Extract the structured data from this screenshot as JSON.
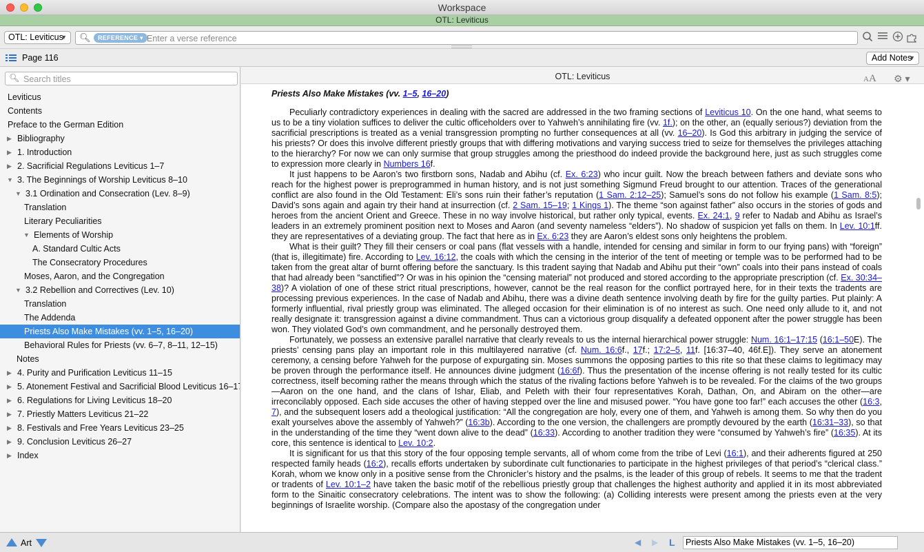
{
  "window": {
    "title": "Workspace",
    "doc_title": "OTL: Leviticus"
  },
  "toolbar": {
    "resource": "OTL: Leviticus",
    "reference_badge": "REFERENCE",
    "search_placeholder": "Enter a verse reference"
  },
  "pagebar": {
    "page": "Page 116",
    "add_notes": "Add Notes"
  },
  "sidebar": {
    "search_placeholder": "Search titles",
    "items": [
      {
        "label": "Leviticus",
        "level": 0,
        "toggle": ""
      },
      {
        "label": "Contents",
        "level": 0,
        "toggle": ""
      },
      {
        "label": "Preface to the German Edition",
        "level": 0,
        "toggle": ""
      },
      {
        "label": "Bibliography",
        "level": 0,
        "toggle": "collapsed"
      },
      {
        "label": "1. Introduction",
        "level": 0,
        "toggle": "collapsed"
      },
      {
        "label": "2. Sacrificial Regulations Leviticus 1–7",
        "level": 0,
        "toggle": "collapsed"
      },
      {
        "label": "3. The Beginnings of Worship Leviticus 8–10",
        "level": 0,
        "toggle": "expanded"
      },
      {
        "label": "3.1 Ordination and Consecration (Lev. 8–9)",
        "level": 1,
        "toggle": "expanded"
      },
      {
        "label": "Translation",
        "level": 2,
        "toggle": ""
      },
      {
        "label": "Literary Peculiarities",
        "level": 2,
        "toggle": ""
      },
      {
        "label": "Elements of Worship",
        "level": 2,
        "toggle": "expanded"
      },
      {
        "label": "A. Standard Cultic Acts",
        "level": 3,
        "toggle": ""
      },
      {
        "label": "The Consecratory Procedures",
        "level": 3,
        "toggle": ""
      },
      {
        "label": "Moses, Aaron, and the Congregation",
        "level": 2,
        "toggle": ""
      },
      {
        "label": "3.2 Rebellion and Correctives (Lev. 10)",
        "level": 1,
        "toggle": "expanded"
      },
      {
        "label": "Translation",
        "level": 2,
        "toggle": ""
      },
      {
        "label": "The Addenda",
        "level": 2,
        "toggle": ""
      },
      {
        "label": "Priests Also Make Mistakes (vv. 1–5, 16–20)",
        "level": 2,
        "toggle": "",
        "selected": true
      },
      {
        "label": "Behavioral Rules for Priests (vv. 6–7, 8–11, 12–15)",
        "level": 2,
        "toggle": ""
      },
      {
        "label": "Notes",
        "level": 1,
        "toggle": ""
      },
      {
        "label": "4. Purity and Purification Leviticus 11–15",
        "level": 0,
        "toggle": "collapsed"
      },
      {
        "label": "5. Atonement Festival and Sacrificial Blood Leviticus 16–17",
        "level": 0,
        "toggle": "collapsed"
      },
      {
        "label": "6. Regulations for Living Leviticus 18–20",
        "level": 0,
        "toggle": "collapsed"
      },
      {
        "label": "7. Priestly Matters Leviticus 21–22",
        "level": 0,
        "toggle": "collapsed"
      },
      {
        "label": "8. Festivals and Free Years Leviticus 23–25",
        "level": 0,
        "toggle": "collapsed"
      },
      {
        "label": "9. Conclusion Leviticus 26–27",
        "level": 0,
        "toggle": "collapsed"
      },
      {
        "label": "Index",
        "level": 0,
        "toggle": "collapsed"
      }
    ]
  },
  "reader": {
    "header_title": "OTL: Leviticus",
    "section_heading": [
      {
        "t": "Priests Also Make Mistakes (vv. "
      },
      {
        "a": "1–5"
      },
      {
        "t": ", "
      },
      {
        "a": "16–20"
      },
      {
        "t": ")"
      }
    ],
    "paragraphs": [
      [
        {
          "t": "Peculiarly contradictory experiences in dealing with the sacred are addressed in the two framing sections of "
        },
        {
          "a": "Leviticus 10"
        },
        {
          "t": ". On the one hand, what seems to us to be a tiny violation suffices to deliver the cultic officeholders over to Yahweh’s annihilating fire (vv. "
        },
        {
          "a": "1f."
        },
        {
          "t": "); on the other, an (equally serious?) deviation from the sacrificial prescriptions is treated as a venial transgression prompting no further consequences at all (vv. "
        },
        {
          "a": "16–20"
        },
        {
          "t": "). Is God this arbitrary in judging the service of his priests? Or does this involve different priestly groups that with differing motivations and varying success tried to seize for themselves the privileges attaching to the hierarchy? For now we can only surmise that group struggles among the priesthood do indeed provide the background here, just as such struggles come to expression more clearly in "
        },
        {
          "a": "Numbers 16"
        },
        {
          "t": "f."
        }
      ],
      [
        {
          "t": "It just happens to be Aaron’s two firstborn sons, Nadab and Abihu (cf. "
        },
        {
          "a": "Ex. 6:23"
        },
        {
          "t": ") who incur guilt. Now the breach between fathers and deviate sons who reach for the highest power is preprogrammed in human history, and is not just something Sigmund Freud brought to our attention. Traces of the generational conflict are also found in the Old Testament: Eli’s sons ruin their father’s reputation ("
        },
        {
          "a": "1 Sam. 2:12–25"
        },
        {
          "t": "); Samuel’s sons do not follow his example ("
        },
        {
          "a": "1 Sam. 8:5"
        },
        {
          "t": "); David’s sons again and again try their hand at insurrection (cf. "
        },
        {
          "a": "2 Sam. 15–19"
        },
        {
          "t": "; "
        },
        {
          "a": "1 Kings 1"
        },
        {
          "t": "). The theme “son against father” also occurs in the stories of gods and heroes from the ancient Orient and Greece. These in no way involve historical, but rather only typical, events. "
        },
        {
          "a": "Ex. 24:1"
        },
        {
          "t": ", "
        },
        {
          "a": "9"
        },
        {
          "t": " refer to Nadab and Abihu as Israel’s leaders in an extremely prominent position next to Moses and Aaron (and seventy nameless “elders”). No shadow of suspicion yet falls on them. In "
        },
        {
          "a": "Lev. 10:1"
        },
        {
          "t": "ff. they are representatives of a deviating group. The fact that here as in "
        },
        {
          "a": "Ex. 6:23"
        },
        {
          "t": " they are Aaron’s eldest sons only heightens the problem."
        }
      ],
      [
        {
          "t": "What is their guilt? They fill their censers or coal pans (flat vessels with a handle, intended for censing and similar in form to our frying pans) with “foreign” (that is, illegitimate) fire. According to "
        },
        {
          "a": "Lev. 16:12"
        },
        {
          "t": ", the coals with which the censing in the interior of the tent of meeting or temple was to be performed had to be taken from the great altar of burnt offering before the sanctuary. Is this tradent saying that Nadab and Abihu put their “own” coals into their pans instead of coals that had already been “sanctified”? Or was in his opinion the “censing material” not produced and stored according to the appropriate prescription (cf. "
        },
        {
          "a": "Ex. 30:34–38"
        },
        {
          "t": ")? A violation of one of these strict ritual prescriptions, however, cannot be the real reason for the conflict portrayed here, for in their texts the tradents are processing previous experiences. In the case of Nadab and Abihu, there was a divine death sentence involving death by fire for the guilty parties. Put plainly: A formerly influential, rival priestly group was eliminated. The alleged occasion for their elimination is of no interest as such. One need only allude to it, and not really designate it: transgression against a divine commandment. Thus can a victorious group disqualify a defeated opponent after the power struggle has been won. They violated God’s own commandment, and he personally destroyed them."
        }
      ],
      [
        {
          "t": "Fortunately, we possess an extensive parallel narrative that clearly reveals to us the internal hierarchical power struggle: "
        },
        {
          "a": "Num. 16:1–17:15"
        },
        {
          "t": " ("
        },
        {
          "a": "16:1–50"
        },
        {
          "t": "E). The priests’ censing pans play an important role in this multilayered narrative (cf. "
        },
        {
          "a": "Num. 16:6"
        },
        {
          "t": "f., "
        },
        {
          "a": "17"
        },
        {
          "t": "f.; "
        },
        {
          "a": "17:2–5"
        },
        {
          "t": ", "
        },
        {
          "a": "11"
        },
        {
          "t": "f. [16:37–40, 46f.E]). They serve an atonement ceremony, a censing before Yahweh for the purpose of expurgating sin. Moses summons the opposing parties to this rite so that these claims to legitimacy may be proven through the performance itself. He announces divine judgment ("
        },
        {
          "a": "16:6f"
        },
        {
          "t": "). Thus the presentation of the incense offering is not really tested for its cultic correctness, itself becoming rather the means through which the status of the rivaling factions before Yahweh is to be revealed. For the claims of the two groups—Aaron on the one hand, and the clans of Ishar, Eliab, and Peleth with their four representatives Korah, Dathan, On, and Abiram on the other—are irreconcilably opposed. Each side accuses the other of having stepped over the line and misused power. “You have gone too far!” each accuses the other ("
        },
        {
          "a": "16:3"
        },
        {
          "t": ", "
        },
        {
          "a": "7"
        },
        {
          "t": "), and the subsequent losers add a theological justification: “All the congregation are holy, every one of them, and Yahweh is among them. So why then do you exalt yourselves above the assembly of Yahweh?” ("
        },
        {
          "a": "16:3b"
        },
        {
          "t": "). According to the one version, the challengers are promptly devoured by the earth ("
        },
        {
          "a": "16:31–33"
        },
        {
          "t": "), so that in the understanding of the time they “went down alive to the dead” ("
        },
        {
          "a": "16:33"
        },
        {
          "t": "). According to another tradition they were “consumed by Yahweh’s fire” ("
        },
        {
          "a": "16:35"
        },
        {
          "t": "). At its core, this sentence is identical to "
        },
        {
          "a": "Lev. 10:2"
        },
        {
          "t": "."
        }
      ],
      [
        {
          "t": "It is significant for us that this story of the four opposing temple servants, all of whom come from the tribe of Levi ("
        },
        {
          "a": "16:1"
        },
        {
          "t": "), and their adherents figured at 250 respected family heads ("
        },
        {
          "a": "16:2"
        },
        {
          "t": "), recalls efforts undertaken by subordinate cult functionaries to participate in the highest privileges of that period’s “clerical class.” Korah, whom we know only in a positive sense from the Chronicler’s history and the psalms, is the leader of this group of rebels. It seems to me that the tradent or tradents of "
        },
        {
          "a": "Lev. 10:1–2"
        },
        {
          "t": " have taken the basic motif of the rebellious priestly group that challenges the highest authority and applied it in its most abbreviated form to the Sinaitic consecratory celebrations. The intent was to show the following: (a) Colliding interests were present among the priests even at the very beginnings of Israelite worship. (Compare also the apostasy of the congregation under"
        }
      ]
    ]
  },
  "bottombar": {
    "art_label": "Art",
    "current_section": "Priests Also Make Mistakes (vv. 1–5, 16–20)"
  }
}
